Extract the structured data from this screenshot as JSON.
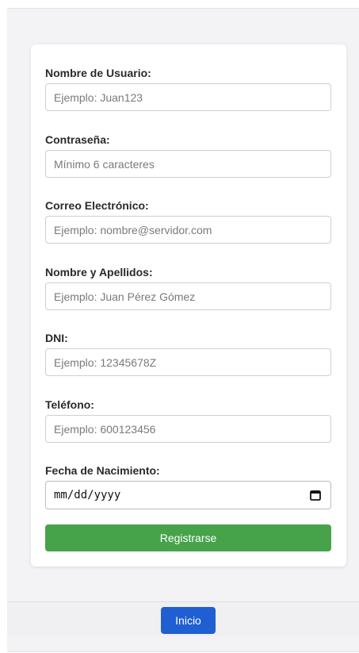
{
  "form": {
    "fields": [
      {
        "label": "Nombre de Usuario:",
        "placeholder": "Ejemplo: Juan123"
      },
      {
        "label": "Contraseña:",
        "placeholder": "Mínimo 6 caracteres"
      },
      {
        "label": "Correo Electrónico:",
        "placeholder": "Ejemplo: nombre@servidor.com"
      },
      {
        "label": "Nombre y Apellidos:",
        "placeholder": "Ejemplo: Juan Pérez Gómez"
      },
      {
        "label": "DNI:",
        "placeholder": "Ejemplo: 12345678Z"
      },
      {
        "label": "Teléfono:",
        "placeholder": "Ejemplo: 600123456"
      }
    ],
    "birthdate": {
      "label": "Fecha de Nacimiento:",
      "value_display": "mm/dd/yyyy",
      "icon": "calendar-icon"
    },
    "submit_label": "Registrarse"
  },
  "footer": {
    "home_label": "Inicio"
  },
  "colors": {
    "submit": "#46a34a",
    "home": "#1f5fd1",
    "background": "#f3f3f5"
  }
}
